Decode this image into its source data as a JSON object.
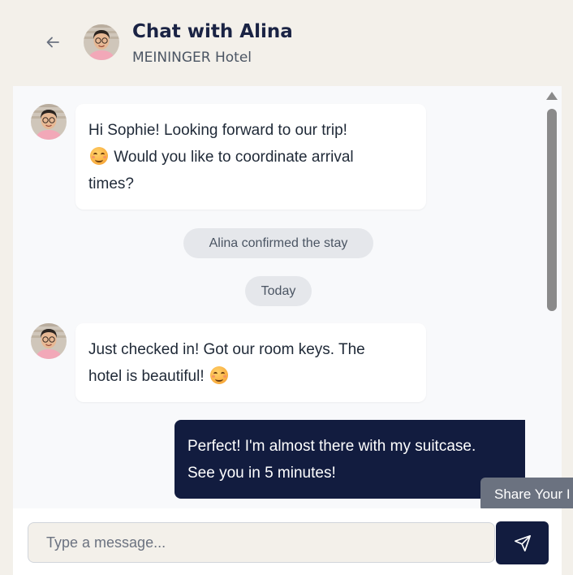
{
  "header": {
    "title": "Chat with Alina",
    "subtitle": "MEININGER Hotel",
    "back_icon": "arrow-left-icon",
    "avatar_icon": "avatar"
  },
  "messages": [
    {
      "type": "incoming",
      "lines": [
        "Hi Sophie! Looking forward to our trip!",
        "Would you like to coordinate arrival",
        "times?"
      ],
      "emoji": "smiling-face"
    },
    {
      "type": "system",
      "text": "Alina confirmed the stay"
    },
    {
      "type": "date",
      "text": "Today"
    },
    {
      "type": "incoming",
      "lines": [
        "Just checked in! Got our room keys. The",
        "hotel is beautiful!"
      ],
      "emoji": "smiling-face"
    },
    {
      "type": "outgoing",
      "lines": [
        "Perfect! I'm almost there with my suitcase.",
        "See you in 5 minutes!"
      ]
    }
  ],
  "tooltip": {
    "text": "Share Your I"
  },
  "composer": {
    "placeholder": "Type a message...",
    "value": "",
    "send_icon": "send-icon"
  },
  "colors": {
    "background": "#f3f0ea",
    "accent": "#121c3f",
    "pill": "#e5e7eb",
    "tooltip": "#6b7280"
  }
}
